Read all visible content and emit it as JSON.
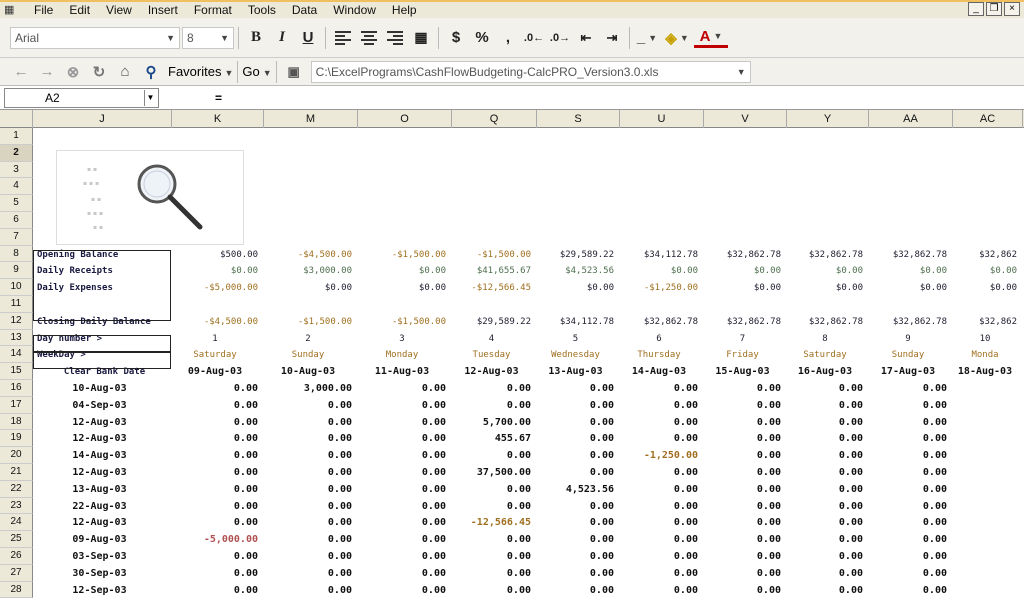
{
  "menu": [
    "File",
    "Edit",
    "View",
    "Insert",
    "Format",
    "Tools",
    "Data",
    "Window",
    "Help"
  ],
  "toolbar": {
    "font": "Arial",
    "size": "8",
    "bold": "B",
    "italic": "I",
    "underline": "U",
    "currency": "$",
    "percent": "%",
    "comma": ",",
    "favorites": "Favorites",
    "go": "Go",
    "path": "C:\\ExcelPrograms\\CashFlowBudgeting-CalcPRO_Version3.0.xls"
  },
  "formula": {
    "cell": "A2",
    "eq": "="
  },
  "columns": [
    "J",
    "K",
    "M",
    "O",
    "Q",
    "S",
    "U",
    "V",
    "Y",
    "AA",
    "AC"
  ],
  "rownums": [
    "1",
    "2",
    "3",
    "4",
    "5",
    "6",
    "7",
    "8",
    "9",
    "10",
    "11",
    "12",
    "13",
    "14",
    "15",
    "16",
    "17",
    "18",
    "19",
    "20",
    "21",
    "22",
    "23",
    "24",
    "25",
    "26",
    "27",
    "28"
  ],
  "labels": {
    "opening": "Opening Balance",
    "receipts": "Daily Receipts",
    "expenses": "Daily Expenses",
    "closing": "Closing Daily Balance",
    "daynum": "Day number >",
    "weekday": "WeekDay >",
    "cleardate": "Clear Bank Date"
  },
  "opening": [
    "$500.00",
    "-$4,500.00",
    "-$1,500.00",
    "-$1,500.00",
    "$29,589.22",
    "$34,112.78",
    "$32,862.78",
    "$32,862.78",
    "$32,862.78",
    "$32,862"
  ],
  "receipts": [
    "$0.00",
    "$3,000.00",
    "$0.00",
    "$41,655.67",
    "$4,523.56",
    "$0.00",
    "$0.00",
    "$0.00",
    "$0.00",
    "$0.00"
  ],
  "expenses": [
    "-$5,000.00",
    "$0.00",
    "$0.00",
    "-$12,566.45",
    "$0.00",
    "-$1,250.00",
    "$0.00",
    "$0.00",
    "$0.00",
    "$0.00"
  ],
  "closing": [
    "-$4,500.00",
    "-$1,500.00",
    "-$1,500.00",
    "$29,589.22",
    "$34,112.78",
    "$32,862.78",
    "$32,862.78",
    "$32,862.78",
    "$32,862.78",
    "$32,862"
  ],
  "daynums": [
    "1",
    "2",
    "3",
    "4",
    "5",
    "6",
    "7",
    "8",
    "9",
    "10"
  ],
  "weekdays": [
    "Saturday",
    "Sunday",
    "Monday",
    "Tuesday",
    "Wednesday",
    "Thursday",
    "Friday",
    "Saturday",
    "Sunday",
    "Monda"
  ],
  "dates": [
    "09-Aug-03",
    "10-Aug-03",
    "11-Aug-03",
    "12-Aug-03",
    "13-Aug-03",
    "14-Aug-03",
    "15-Aug-03",
    "16-Aug-03",
    "17-Aug-03",
    "18-Aug-03"
  ],
  "rows": [
    {
      "date": "10-Aug-03",
      "vals": [
        "0.00",
        "3,000.00",
        "0.00",
        "0.00",
        "0.00",
        "0.00",
        "0.00",
        "0.00",
        "0.00"
      ]
    },
    {
      "date": "04-Sep-03",
      "vals": [
        "0.00",
        "0.00",
        "0.00",
        "0.00",
        "0.00",
        "0.00",
        "0.00",
        "0.00",
        "0.00"
      ]
    },
    {
      "date": "12-Aug-03",
      "vals": [
        "0.00",
        "0.00",
        "0.00",
        "5,700.00",
        "0.00",
        "0.00",
        "0.00",
        "0.00",
        "0.00"
      ]
    },
    {
      "date": "12-Aug-03",
      "vals": [
        "0.00",
        "0.00",
        "0.00",
        "455.67",
        "0.00",
        "0.00",
        "0.00",
        "0.00",
        "0.00"
      ]
    },
    {
      "date": "14-Aug-03",
      "vals": [
        "0.00",
        "0.00",
        "0.00",
        "0.00",
        "0.00",
        "-1,250.00",
        "0.00",
        "0.00",
        "0.00"
      ]
    },
    {
      "date": "12-Aug-03",
      "vals": [
        "0.00",
        "0.00",
        "0.00",
        "37,500.00",
        "0.00",
        "0.00",
        "0.00",
        "0.00",
        "0.00"
      ]
    },
    {
      "date": "13-Aug-03",
      "vals": [
        "0.00",
        "0.00",
        "0.00",
        "0.00",
        "4,523.56",
        "0.00",
        "0.00",
        "0.00",
        "0.00"
      ]
    },
    {
      "date": "22-Aug-03",
      "vals": [
        "0.00",
        "0.00",
        "0.00",
        "0.00",
        "0.00",
        "0.00",
        "0.00",
        "0.00",
        "0.00"
      ]
    },
    {
      "date": "12-Aug-03",
      "vals": [
        "0.00",
        "0.00",
        "0.00",
        "-12,566.45",
        "0.00",
        "0.00",
        "0.00",
        "0.00",
        "0.00"
      ]
    },
    {
      "date": "09-Aug-03",
      "vals": [
        "-5,000.00",
        "0.00",
        "0.00",
        "0.00",
        "0.00",
        "0.00",
        "0.00",
        "0.00",
        "0.00"
      ]
    },
    {
      "date": "03-Sep-03",
      "vals": [
        "0.00",
        "0.00",
        "0.00",
        "0.00",
        "0.00",
        "0.00",
        "0.00",
        "0.00",
        "0.00"
      ]
    },
    {
      "date": "30-Sep-03",
      "vals": [
        "0.00",
        "0.00",
        "0.00",
        "0.00",
        "0.00",
        "0.00",
        "0.00",
        "0.00",
        "0.00"
      ]
    },
    {
      "date": "12-Sep-03",
      "vals": [
        "0.00",
        "0.00",
        "0.00",
        "0.00",
        "0.00",
        "0.00",
        "0.00",
        "0.00",
        "0.00"
      ]
    }
  ]
}
